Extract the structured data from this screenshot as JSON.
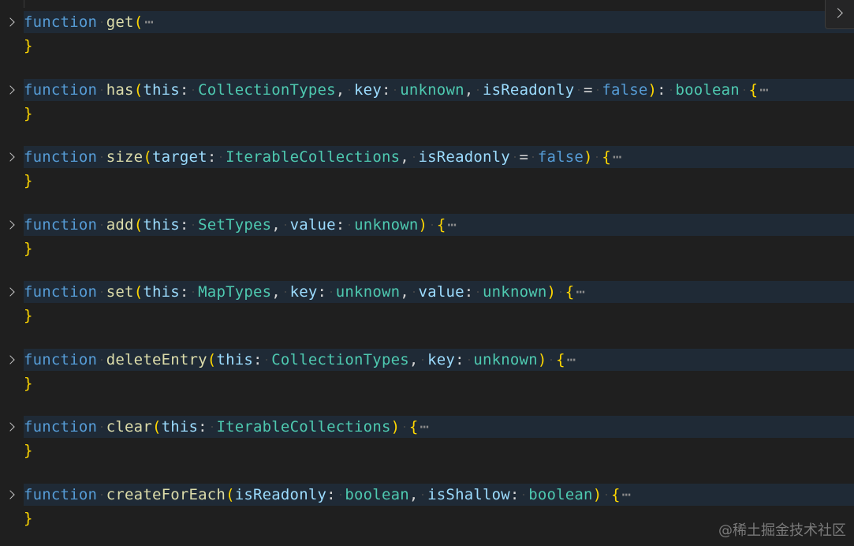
{
  "editor": {
    "collapsed_placeholder": "⋯",
    "closing_brace": "}",
    "functions": [
      {
        "signature": [
          {
            "t": "kw",
            "v": "function"
          },
          {
            "t": "sp"
          },
          {
            "t": "fn",
            "v": "get"
          },
          {
            "t": "p1",
            "v": "("
          }
        ]
      },
      {
        "signature": [
          {
            "t": "kw",
            "v": "function"
          },
          {
            "t": "sp"
          },
          {
            "t": "fn",
            "v": "has"
          },
          {
            "t": "p1",
            "v": "("
          },
          {
            "t": "vr",
            "v": "this"
          },
          {
            "t": "pn",
            "v": ":"
          },
          {
            "t": "sp"
          },
          {
            "t": "ty",
            "v": "CollectionTypes"
          },
          {
            "t": "pn",
            "v": ","
          },
          {
            "t": "sp"
          },
          {
            "t": "vr",
            "v": "key"
          },
          {
            "t": "pn",
            "v": ":"
          },
          {
            "t": "sp"
          },
          {
            "t": "ty",
            "v": "unknown"
          },
          {
            "t": "pn",
            "v": ","
          },
          {
            "t": "sp"
          },
          {
            "t": "vr",
            "v": "isReadonly"
          },
          {
            "t": "sp"
          },
          {
            "t": "pn",
            "v": "="
          },
          {
            "t": "sp"
          },
          {
            "t": "bool",
            "v": "false"
          },
          {
            "t": "p1",
            "v": ")"
          },
          {
            "t": "pn",
            "v": ":"
          },
          {
            "t": "sp"
          },
          {
            "t": "ty",
            "v": "boolean"
          },
          {
            "t": "sp"
          },
          {
            "t": "p1",
            "v": "{"
          }
        ]
      },
      {
        "signature": [
          {
            "t": "kw",
            "v": "function"
          },
          {
            "t": "sp"
          },
          {
            "t": "fn",
            "v": "size"
          },
          {
            "t": "p1",
            "v": "("
          },
          {
            "t": "vr",
            "v": "target"
          },
          {
            "t": "pn",
            "v": ":"
          },
          {
            "t": "sp"
          },
          {
            "t": "ty",
            "v": "IterableCollections"
          },
          {
            "t": "pn",
            "v": ","
          },
          {
            "t": "sp"
          },
          {
            "t": "vr",
            "v": "isReadonly"
          },
          {
            "t": "sp"
          },
          {
            "t": "pn",
            "v": "="
          },
          {
            "t": "sp"
          },
          {
            "t": "bool",
            "v": "false"
          },
          {
            "t": "p1",
            "v": ")"
          },
          {
            "t": "sp"
          },
          {
            "t": "p1",
            "v": "{"
          }
        ]
      },
      {
        "signature": [
          {
            "t": "kw",
            "v": "function"
          },
          {
            "t": "sp"
          },
          {
            "t": "fn",
            "v": "add"
          },
          {
            "t": "p1",
            "v": "("
          },
          {
            "t": "vr",
            "v": "this"
          },
          {
            "t": "pn",
            "v": ":"
          },
          {
            "t": "sp"
          },
          {
            "t": "ty",
            "v": "SetTypes"
          },
          {
            "t": "pn",
            "v": ","
          },
          {
            "t": "sp"
          },
          {
            "t": "vr",
            "v": "value"
          },
          {
            "t": "pn",
            "v": ":"
          },
          {
            "t": "sp"
          },
          {
            "t": "ty",
            "v": "unknown"
          },
          {
            "t": "p1",
            "v": ")"
          },
          {
            "t": "sp"
          },
          {
            "t": "p1",
            "v": "{"
          }
        ]
      },
      {
        "signature": [
          {
            "t": "kw",
            "v": "function"
          },
          {
            "t": "sp"
          },
          {
            "t": "fn",
            "v": "set"
          },
          {
            "t": "p1",
            "v": "("
          },
          {
            "t": "vr",
            "v": "this"
          },
          {
            "t": "pn",
            "v": ":"
          },
          {
            "t": "sp"
          },
          {
            "t": "ty",
            "v": "MapTypes"
          },
          {
            "t": "pn",
            "v": ","
          },
          {
            "t": "sp"
          },
          {
            "t": "vr",
            "v": "key"
          },
          {
            "t": "pn",
            "v": ":"
          },
          {
            "t": "sp"
          },
          {
            "t": "ty",
            "v": "unknown"
          },
          {
            "t": "pn",
            "v": ","
          },
          {
            "t": "sp"
          },
          {
            "t": "vr",
            "v": "value"
          },
          {
            "t": "pn",
            "v": ":"
          },
          {
            "t": "sp"
          },
          {
            "t": "ty",
            "v": "unknown"
          },
          {
            "t": "p1",
            "v": ")"
          },
          {
            "t": "sp"
          },
          {
            "t": "p1",
            "v": "{"
          }
        ]
      },
      {
        "signature": [
          {
            "t": "kw",
            "v": "function"
          },
          {
            "t": "sp"
          },
          {
            "t": "fn",
            "v": "deleteEntry"
          },
          {
            "t": "p1",
            "v": "("
          },
          {
            "t": "vr",
            "v": "this"
          },
          {
            "t": "pn",
            "v": ":"
          },
          {
            "t": "sp"
          },
          {
            "t": "ty",
            "v": "CollectionTypes"
          },
          {
            "t": "pn",
            "v": ","
          },
          {
            "t": "sp"
          },
          {
            "t": "vr",
            "v": "key"
          },
          {
            "t": "pn",
            "v": ":"
          },
          {
            "t": "sp"
          },
          {
            "t": "ty",
            "v": "unknown"
          },
          {
            "t": "p1",
            "v": ")"
          },
          {
            "t": "sp"
          },
          {
            "t": "p1",
            "v": "{"
          }
        ]
      },
      {
        "signature": [
          {
            "t": "kw",
            "v": "function"
          },
          {
            "t": "sp"
          },
          {
            "t": "fn",
            "v": "clear"
          },
          {
            "t": "p1",
            "v": "("
          },
          {
            "t": "vr",
            "v": "this"
          },
          {
            "t": "pn",
            "v": ":"
          },
          {
            "t": "sp"
          },
          {
            "t": "ty",
            "v": "IterableCollections"
          },
          {
            "t": "p1",
            "v": ")"
          },
          {
            "t": "sp"
          },
          {
            "t": "p1",
            "v": "{"
          }
        ]
      },
      {
        "signature": [
          {
            "t": "kw",
            "v": "function"
          },
          {
            "t": "sp"
          },
          {
            "t": "fn",
            "v": "createForEach"
          },
          {
            "t": "p1",
            "v": "("
          },
          {
            "t": "vr",
            "v": "isReadonly"
          },
          {
            "t": "pn",
            "v": ":"
          },
          {
            "t": "sp"
          },
          {
            "t": "ty",
            "v": "boolean"
          },
          {
            "t": "pn",
            "v": ","
          },
          {
            "t": "sp"
          },
          {
            "t": "vr",
            "v": "isShallow"
          },
          {
            "t": "pn",
            "v": ":"
          },
          {
            "t": "sp"
          },
          {
            "t": "ty",
            "v": "boolean"
          },
          {
            "t": "p1",
            "v": ")"
          },
          {
            "t": "sp"
          },
          {
            "t": "p1",
            "v": "{"
          }
        ]
      }
    ]
  },
  "watermark": "@稀土掘金技术社区"
}
